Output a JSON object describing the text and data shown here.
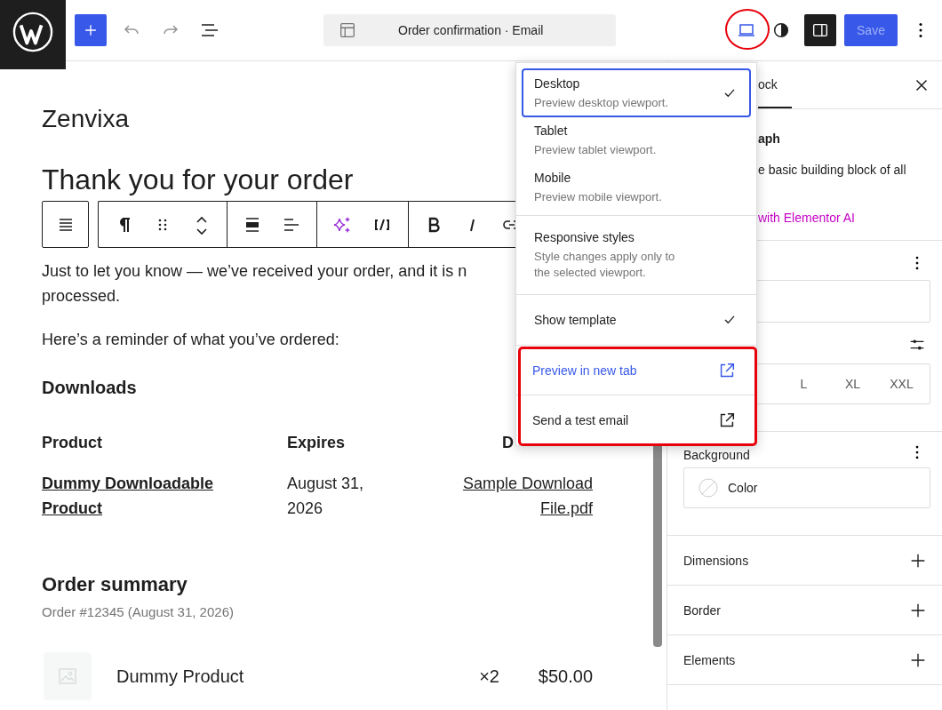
{
  "topbar": {
    "document_title": "Order confirmation · Email",
    "device_button": {
      "highlighted": true
    },
    "save_button": {
      "label": "Save",
      "disabled": true
    }
  },
  "email": {
    "site_title": "Zenvixa",
    "heading": "Thank you for your order",
    "intro_lines": [
      "Just to let you know — we’ve received your order, and it is n",
      "processed."
    ],
    "reminder": "Here’s a reminder of what you’ve ordered:",
    "downloads": {
      "title": "Downloads",
      "columns": [
        "Product",
        "Expires",
        "D"
      ],
      "rows": [
        {
          "product": "Dummy Downloadable Product",
          "expires": "August 31, 2026",
          "file": "Sample Download File.pdf"
        }
      ]
    },
    "summary": {
      "title": "Order summary",
      "meta": "Order #12345 (August 31, 2026)",
      "items": [
        {
          "name": "Dummy Product",
          "quantity": "×2",
          "price": "$50.00"
        }
      ]
    }
  },
  "preview_menu": {
    "devices": [
      {
        "label": "Desktop",
        "description": "Preview desktop viewport.",
        "selected": true
      },
      {
        "label": "Tablet",
        "description": "Preview tablet viewport.",
        "selected": false
      },
      {
        "label": "Mobile",
        "description": "Preview mobile viewport.",
        "selected": false
      }
    ],
    "responsive": {
      "label": "Responsive styles",
      "description": "Style changes apply only to the selected viewport."
    },
    "show_template": {
      "label": "Show template",
      "checked": true
    },
    "links": {
      "highlighted": true,
      "items": [
        {
          "label": "Preview in new tab",
          "accent": true
        },
        {
          "label": "Send a test email",
          "accent": false
        }
      ]
    }
  },
  "sidebar": {
    "tab": "ock",
    "block_title": "aph",
    "block_description": "e basic building block of all",
    "ai_link": "with Elementor AI",
    "sizes": [
      "L",
      "XL",
      "XXL"
    ],
    "background_title": "Background",
    "color_label": "Color",
    "panels": [
      "Dimensions",
      "Border",
      "Elements"
    ]
  }
}
